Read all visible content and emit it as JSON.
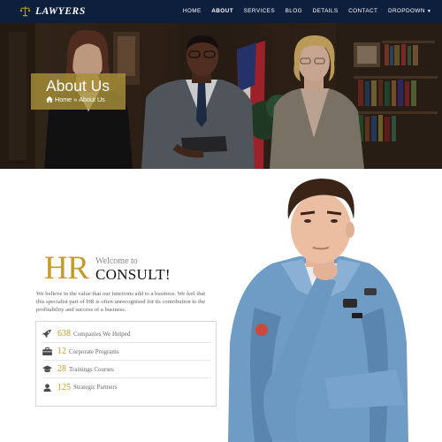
{
  "brand": {
    "name": "LAWYERS",
    "logo_icon": "scales-icon"
  },
  "nav": {
    "items": [
      {
        "label": "HOME"
      },
      {
        "label": "ABOUT",
        "active": true
      },
      {
        "label": "SERVICES"
      },
      {
        "label": "BLOG"
      },
      {
        "label": "DETAILS"
      },
      {
        "label": "CONTACT"
      },
      {
        "label": "DROPDOWN"
      }
    ]
  },
  "hero": {
    "title": "About Us",
    "breadcrumb_home": "Home",
    "breadcrumb_sep": "»",
    "breadcrumb_current": "About Us"
  },
  "intro": {
    "hr": "HR",
    "welcome": "Welcome to",
    "consult": "CONSULT!",
    "description": "We believe in the value that our functions add to a business. We feel that this specialist part of HR is often unrecognised for its contribution to the profitability and success of a business."
  },
  "stats": [
    {
      "icon": "rocket-icon",
      "value": "638",
      "label": "Companies We Helped"
    },
    {
      "icon": "briefcase-icon",
      "value": "12",
      "label": "Corporate Programs"
    },
    {
      "icon": "graduation-cap-icon",
      "value": "28",
      "label": "Trainings Courses"
    },
    {
      "icon": "user-icon",
      "value": "125",
      "label": "Strategic Partners"
    }
  ],
  "colors": {
    "nav_bg": "#0e1e3d",
    "accent": "#c49a2c",
    "hero_box": "#a89038"
  }
}
